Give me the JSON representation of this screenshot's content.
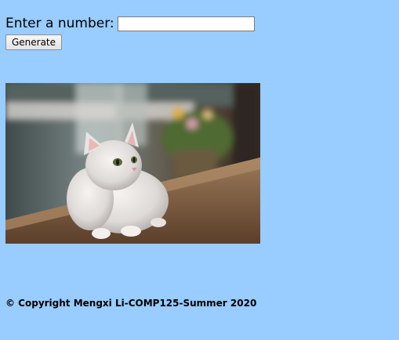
{
  "form": {
    "prompt_label": "Enter a number:",
    "input_value": "",
    "input_placeholder": "",
    "generate_label": "Generate"
  },
  "image": {
    "subject": "white-cat-photo"
  },
  "footer": {
    "copyright": "© Copyright Mengxi Li-COMP125-Summer 2020"
  },
  "colors": {
    "page_background": "#99ccff"
  }
}
